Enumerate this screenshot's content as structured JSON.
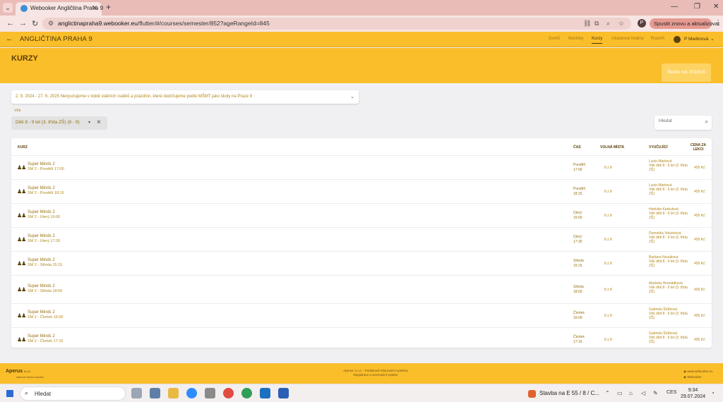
{
  "browser": {
    "tab_title": "Webooker Angličtina Praha 9",
    "url_host": "anglictinapraha9.webooker.eu",
    "url_path": "/flutter/#/courses/semester/852?ageRangeId=845",
    "relaunch_label": "Spustit znovu a aktualizovat",
    "profile_initial": "P"
  },
  "app": {
    "title": "ANGLIČTINA PRAHA 9",
    "nav": [
      {
        "label": "Domů"
      },
      {
        "label": "Novinky"
      },
      {
        "label": "Kurzy"
      },
      {
        "label": "Ukázkové hodiny"
      },
      {
        "label": "Rozvrh"
      }
    ],
    "user_name": "P Medinová"
  },
  "page": {
    "title": "KURZY",
    "year_tab": "Školní rok 2024/25",
    "semester": "2. 9. 2024 - 27. 6. 2025 Nevyučujeme v době státních svátků a prázdnin, které dodržujeme podle MŠMT jako školy na Praze 9",
    "age_label": "Věk",
    "age_value": "Děti 8 - 9 let (3. třída ZŠ) (8 - 9)",
    "search_placeholder": "Hledat"
  },
  "table": {
    "headers": {
      "course": "KURZ",
      "time": "ČAS",
      "seats": "VOLNÁ MÍSTA",
      "teacher": "VYUČUJÍCÍ",
      "price": "CENA ZA LEKCI"
    },
    "rows": [
      {
        "name": "Super Minds 2",
        "sub": "SM 2 - Pondělí 17:00",
        "day": "Pondělí",
        "time": "17:00",
        "seats": "8 z 8",
        "teacher": "Lucie Marková",
        "group": "Věk děti 8 - 9 let (3. třída ZŠ)",
        "price": "405 Kč"
      },
      {
        "name": "Super Minds 2",
        "sub": "SM 2 - Pondělí 18:15",
        "day": "Pondělí",
        "time": "18:15",
        "seats": "8 z 8",
        "teacher": "Lucie Marková",
        "group": "Věk děti 8 - 9 let (3. třída ZŠ)",
        "price": "405 Kč"
      },
      {
        "name": "Super Minds 2",
        "sub": "SM 2 - Úterý 16:00",
        "day": "Úterý",
        "time": "16:00",
        "seats": "8 z 8",
        "teacher": "Hedvika Karbulová",
        "group": "Věk děti 8 - 9 let (3. třída ZŠ)",
        "price": "405 Kč"
      },
      {
        "name": "Super Minds 2",
        "sub": "SM 2 - Úterý 17:30",
        "day": "Úterý",
        "time": "17:30",
        "seats": "8 z 8",
        "teacher": "Dominika Vokurková",
        "group": "Věk děti 8 - 9 let (3. třída ZŠ)",
        "price": "405 Kč"
      },
      {
        "name": "Super Minds 2",
        "sub": "SM 2 - Středa 15:15",
        "day": "Středa",
        "time": "15:15",
        "seats": "8 z 8",
        "teacher": "Barbara Nováková",
        "group": "Věk děti 8 - 9 let (3. třída ZŠ)",
        "price": "405 Kč"
      },
      {
        "name": "Super Minds 2",
        "sub": "SM 2 - Středa 18:00",
        "day": "Středa",
        "time": "18:00",
        "seats": "8 z 8",
        "teacher": "Markéta Hromádková",
        "group": "Věk děti 8 - 9 let (3. třída ZŠ)",
        "price": "405 Kč"
      },
      {
        "name": "Super Minds 2",
        "sub": "SM 2 - Čtvrtek 16:00",
        "day": "Čtvrtek",
        "time": "16:00",
        "seats": "8 z 8",
        "teacher": "Gabriela Šrůtková",
        "group": "Věk děti 8 - 9 let (3. třída ZŠ)",
        "price": "405 Kč"
      },
      {
        "name": "Super Minds 2",
        "sub": "SM 2 - Čtvrtek 17:15",
        "day": "Čtvrtek",
        "time": "17:15",
        "seats": "8 z 8",
        "teacher": "Gabriela Šrůtková",
        "group": "Věk děti 8 - 9 let (3. třída ZŠ)",
        "price": "405 Kč"
      }
    ]
  },
  "footer": {
    "logo": "Aperus",
    "logo_suffix": "s.r.o.",
    "tagline": "webové řešení služeb",
    "center_line1": "Aperus, s.r.o. - Podnikové informační systémy",
    "center_line2": "Registrace a rezervační systém",
    "right_line1": "www.webooker.eu",
    "right_line2": "Webooker"
  },
  "taskbar": {
    "search_label": "Hledat",
    "news": "Stavba na E 55 / 8 / C...",
    "lang": "CES",
    "time": "9:34",
    "date": "29.07.2024"
  },
  "colors": {
    "accent": "#fbbe2b",
    "accent_text": "#9a6f12"
  }
}
